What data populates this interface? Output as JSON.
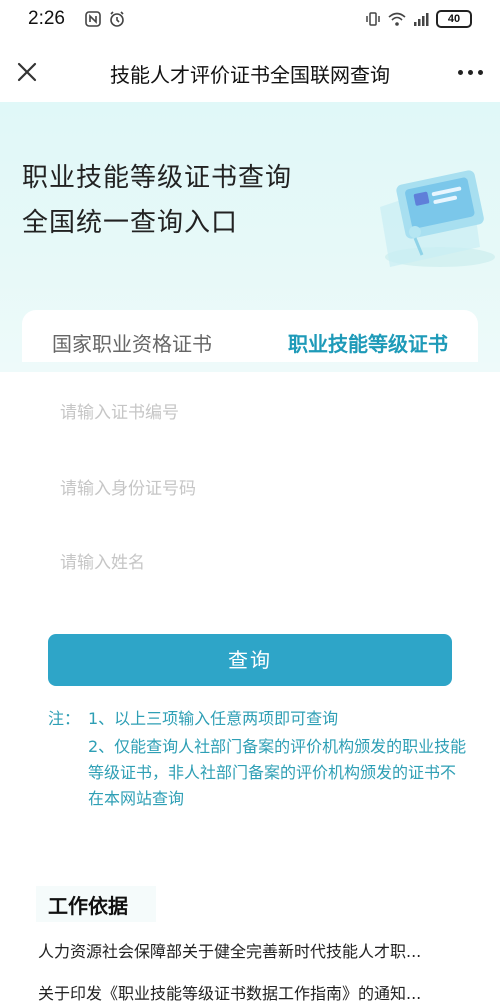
{
  "status_bar": {
    "time": "2:26",
    "battery": "40"
  },
  "title_bar": {
    "title": "技能人才评价证书全国联网查询"
  },
  "hero": {
    "line1": "职业技能等级证书查询",
    "line2": "全国统一查询入口"
  },
  "tabs": [
    {
      "label": "国家职业资格证书",
      "active": false
    },
    {
      "label": "职业技能等级证书",
      "active": true
    }
  ],
  "form": {
    "cert_number_placeholder": "请输入证书编号",
    "id_number_placeholder": "请输入身份证号码",
    "name_placeholder": "请输入姓名",
    "submit_label": "查询"
  },
  "notes": {
    "label": "注：",
    "item1": "1、以上三项输入任意两项即可查询",
    "item2": "2、仅能查询人社部门备案的评价机构颁发的职业技能等级证书，非人社部门备案的评价机构颁发的证书不在本网站查询"
  },
  "work_basis": {
    "title": "工作依据",
    "links": [
      "人力资源社会保障部关于健全完善新时代技能人才职...",
      "关于印发《职业技能等级证书数据工作指南》的通知..."
    ]
  },
  "colors": {
    "accent": "#2ea5c8",
    "tab_active": "#1e9ab8",
    "note_text": "#2e9fb5",
    "hero_bg": "#e0f8f8"
  }
}
